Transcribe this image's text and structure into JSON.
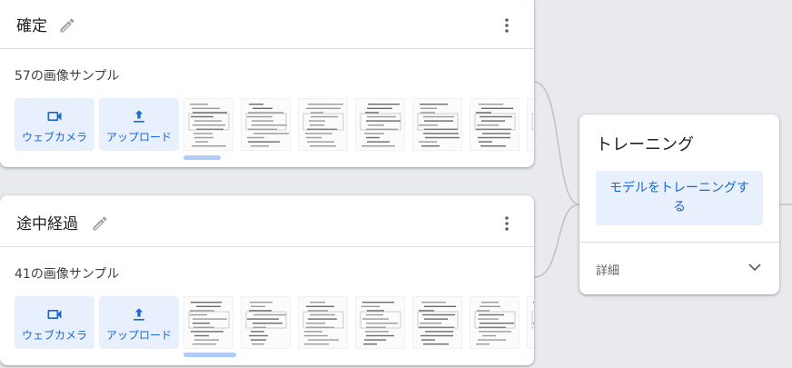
{
  "classes": [
    {
      "title": "確定",
      "samples": "57の画像サンプル",
      "webcam_label": "ウェブカメラ",
      "upload_label": "アップロード",
      "thumbnail_count": 7
    },
    {
      "title": "途中経過",
      "samples": "41の画像サンプル",
      "webcam_label": "ウェブカメラ",
      "upload_label": "アップロード",
      "thumbnail_count": 7
    }
  ],
  "training": {
    "title": "トレーニング",
    "train_button": "モデルをトレーニングする",
    "details_label": "詳細"
  },
  "icons": {
    "edit": "pencil-icon",
    "menu": "more-vert-icon",
    "webcam": "videocam-icon",
    "upload": "upload-icon",
    "expand": "chevron-down-icon"
  },
  "colors": {
    "accent": "#1967d2",
    "button_bg": "#e8f0fe",
    "canvas": "#e8eaed",
    "scroll_thumb": "#aecbfa"
  }
}
